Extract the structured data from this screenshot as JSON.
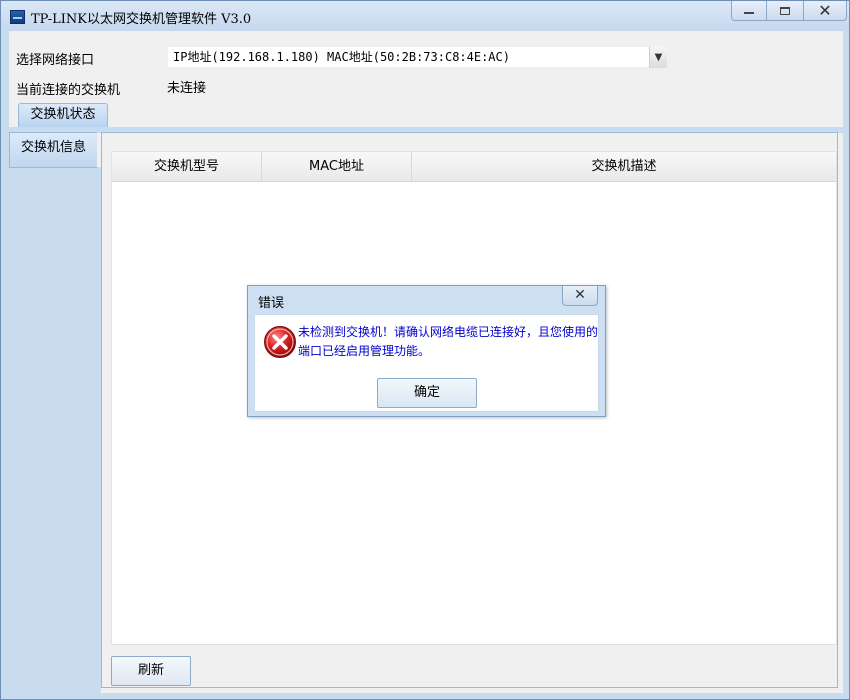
{
  "window": {
    "title": "TP-LINK以太网交换机管理软件 V3.0",
    "minimize_icon": "minimize-icon",
    "maximize_icon": "maximize-icon",
    "close_icon": "close-icon",
    "close_glyph": "✕"
  },
  "form": {
    "interface_label": "选择网络接口",
    "interface_value": "IP地址(192.168.1.180)   MAC地址(50:2B:73:C8:4E:AC)",
    "dropdown_glyph": "▼",
    "connected_label": "当前连接的交换机",
    "connected_value": "未连接"
  },
  "tabs": {
    "top": "交换机状态",
    "side": "交换机信息"
  },
  "table": {
    "columns": [
      "交换机型号",
      "MAC地址",
      "交换机描述"
    ],
    "rows": []
  },
  "buttons": {
    "refresh": "刷新"
  },
  "dialog": {
    "title": "错误",
    "close_glyph": "✕",
    "icon": "error-icon",
    "message": "未检测到交换机！请确认网络电缆已连接好，且您使用的端口已经启用管理功能。",
    "ok": "确定"
  },
  "colors": {
    "accent": "#c9dcef",
    "message_text": "#0000cc",
    "error_red": "#d21f1f"
  }
}
